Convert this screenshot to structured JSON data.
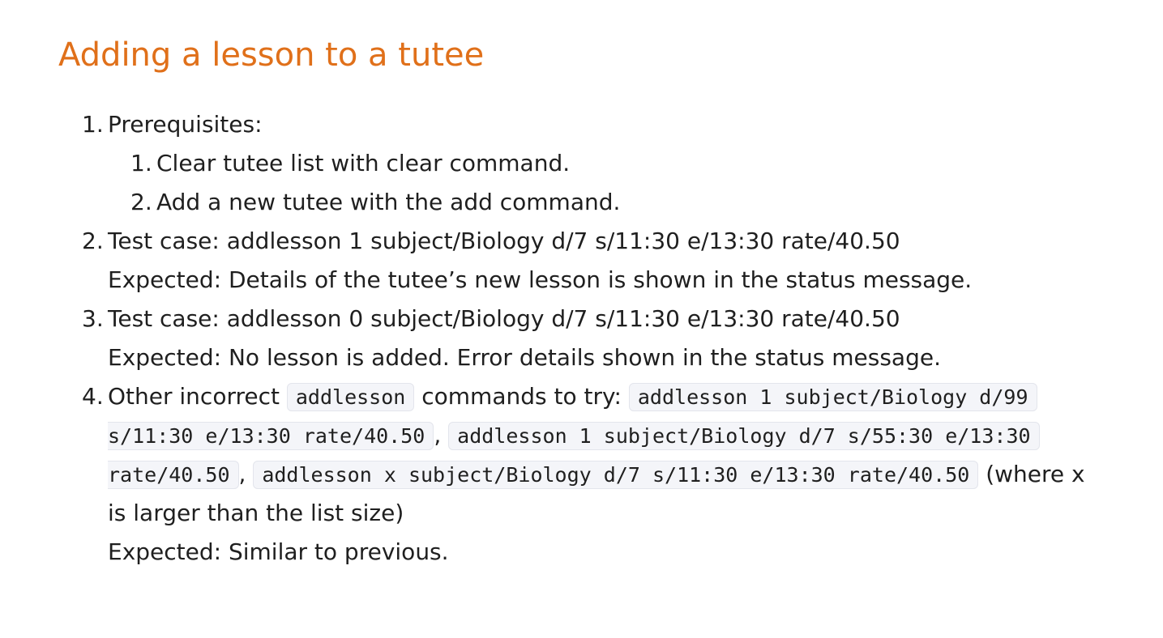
{
  "title": "Adding a lesson to a tutee",
  "items": [
    {
      "num": "1.",
      "text": "Prerequisites:",
      "subitems": [
        {
          "num": "1.",
          "text": "Clear tutee list with clear command."
        },
        {
          "num": "2.",
          "text": "Add a new tutee with the add command."
        }
      ]
    },
    {
      "num": "2.",
      "text": "Test case: addlesson 1 subject/Biology d/7 s/11:30 e/13:30 rate/40.50",
      "expected": "Expected: Details of the tutee’s new lesson is shown in the status message."
    },
    {
      "num": "3.",
      "text": "Test case: addlesson 0 subject/Biology d/7 s/11:30 e/13:30 rate/40.50",
      "expected": "Expected: No lesson is added. Error details shown in the status message."
    },
    {
      "num": "4.",
      "intro": "Other incorrect",
      "intro_code": "addlesson",
      "middle": "commands to try:",
      "code1_part1": "addlesson 1 subject/Biology d/99",
      "code1_part2": "s/11:30 e/13:30 rate/40.50",
      "sep1": ",",
      "code2_part1": "addlesson 1 subject/Biology d/7 s/55:30 e/13:30",
      "code2_part2": "rate/40.50",
      "sep2": ",",
      "code3": "addlesson x subject/Biology d/7 s/11:30 e/13:30 rate/40.50",
      "trail1": "(where x",
      "trail2": "is larger than the list size)",
      "expected": "Expected: Similar to previous."
    }
  ]
}
